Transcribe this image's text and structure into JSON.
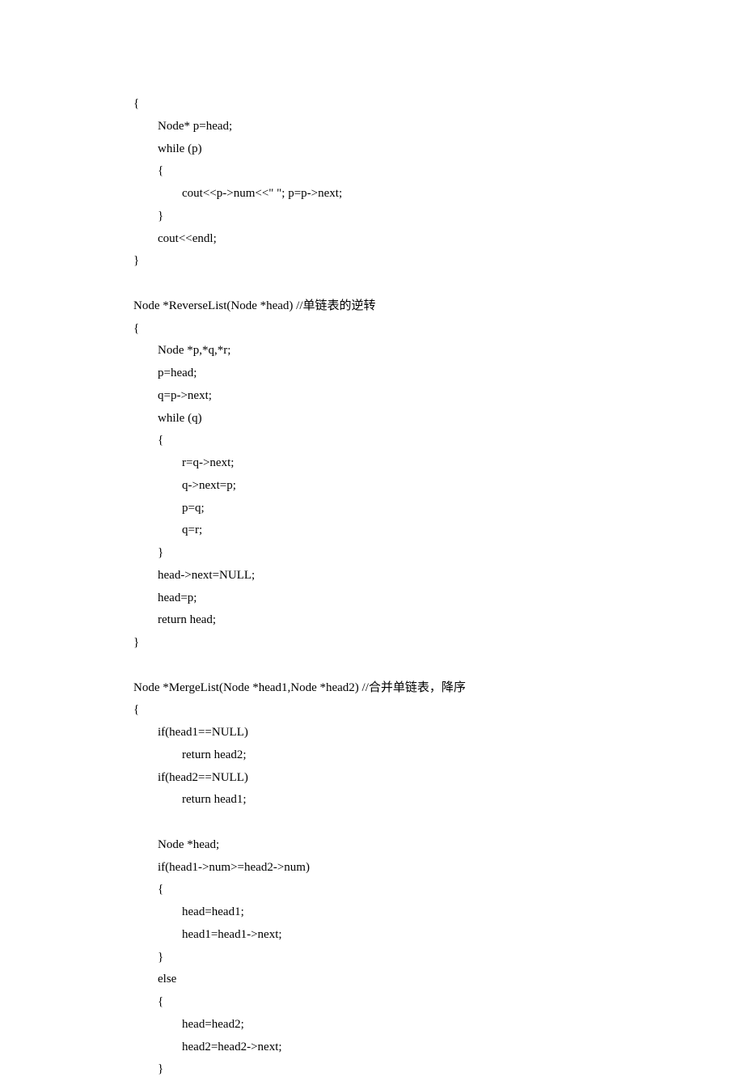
{
  "code": {
    "lines": [
      "{",
      "        Node* p=head;",
      "        while (p)",
      "        {",
      "                cout<<p->num<<\" \"; p=p->next;",
      "        }",
      "        cout<<endl;",
      "}",
      "",
      "Node *ReverseList(Node *head) //单链表的逆转",
      "{",
      "        Node *p,*q,*r;",
      "        p=head;",
      "        q=p->next;",
      "        while (q)",
      "        {",
      "                r=q->next;",
      "                q->next=p;",
      "                p=q;",
      "                q=r;",
      "        }",
      "        head->next=NULL;",
      "        head=p;",
      "        return head;",
      "}",
      "",
      "Node *MergeList(Node *head1,Node *head2) //合并单链表，降序",
      "{",
      "        if(head1==NULL)",
      "                return head2;",
      "        if(head2==NULL)",
      "                return head1;",
      "",
      "        Node *head;",
      "        if(head1->num>=head2->num)",
      "        {",
      "                head=head1;",
      "                head1=head1->next;",
      "        }",
      "        else",
      "        {",
      "                head=head2;",
      "                head2=head2->next;",
      "        }"
    ]
  }
}
